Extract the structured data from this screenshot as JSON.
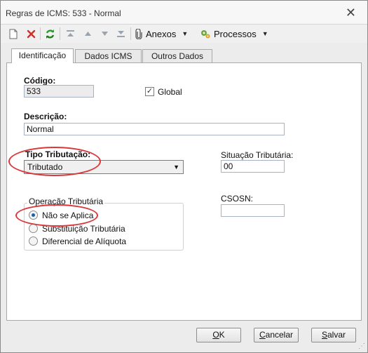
{
  "window": {
    "title": "Regras de ICMS: 533 - Normal",
    "close_glyph": "✕"
  },
  "toolbar": {
    "new_icon": "document-icon",
    "delete_icon": "red-x-icon",
    "refresh_icon": "refresh-icon",
    "first_icon": "first-record-icon",
    "prev_icon": "up-arrow-icon",
    "next_icon": "down-arrow-icon",
    "last_icon": "last-record-icon",
    "attachments_label": "Anexos",
    "processes_label": "Processos"
  },
  "tabs": [
    "Identificação",
    "Dados ICMS",
    "Outros Dados"
  ],
  "form": {
    "codigo_label": "Código:",
    "codigo_value": "533",
    "global_label": "Global",
    "global_checked": true,
    "descricao_label": "Descrição:",
    "descricao_value": "Normal",
    "tipo_label": "Tipo Tributação:",
    "tipo_value": "Tributado",
    "situacao_label": "Situação Tributária:",
    "situacao_value": "00",
    "csosn_label": "CSOSN:",
    "csosn_value": "",
    "operacao_title": "Operação Tributária",
    "operacao_options": [
      "Não se Aplica",
      "Substituição Tributária",
      "Diferencial de Alíquota"
    ],
    "operacao_selected": 0
  },
  "buttons": {
    "ok_u": "O",
    "ok_rest": "K",
    "cancel_u": "C",
    "cancel_rest": "ancelar",
    "save_u": "S",
    "save_rest": "alvar"
  },
  "colors": {
    "annotation": "#d9373a",
    "radio_selected": "#1b5fae"
  }
}
